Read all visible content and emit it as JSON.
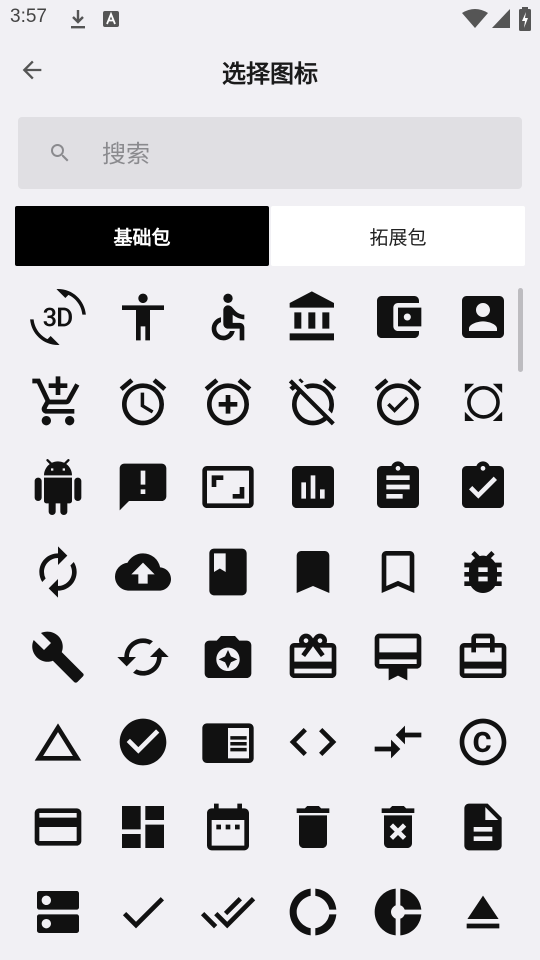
{
  "status_bar": {
    "time": "3:57"
  },
  "header": {
    "title": "选择图标"
  },
  "search": {
    "placeholder": "搜索"
  },
  "tabs": [
    {
      "label": "基础包"
    },
    {
      "label": "拓展包"
    }
  ],
  "icons": [
    "3d-rotation-icon",
    "accessibility-icon",
    "accessible-icon",
    "account-balance-icon",
    "account-balance-wallet-icon",
    "account-box-icon",
    "add-shopping-cart-icon",
    "alarm-icon",
    "alarm-add-icon",
    "alarm-off-icon",
    "alarm-on-icon",
    "all-out-icon",
    "android-icon",
    "announcement-icon",
    "aspect-ratio-icon",
    "assessment-icon",
    "assignment-icon",
    "assignment-turned-in-icon",
    "autorenew-icon",
    "backup-icon",
    "book-icon",
    "bookmark-icon",
    "bookmark-border-icon",
    "bug-report-icon",
    "build-icon",
    "cached-icon",
    "camera-enhance-icon",
    "card-giftcard-icon",
    "card-membership-icon",
    "card-travel-icon",
    "change-history-icon",
    "check-circle-icon",
    "chrome-reader-mode-icon",
    "code-icon",
    "compare-arrows-icon",
    "copyright-icon",
    "credit-card-icon",
    "dashboard-icon",
    "date-range-icon",
    "delete-icon",
    "delete-forever-icon",
    "description-icon",
    "dns-icon",
    "done-icon",
    "done-all-icon",
    "donut-large-icon",
    "donut-small-icon",
    "eject-icon"
  ]
}
